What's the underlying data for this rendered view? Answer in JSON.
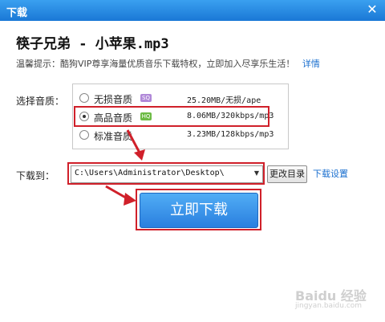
{
  "window": {
    "title": "下载",
    "close_glyph": "✕"
  },
  "song": {
    "name": "筷子兄弟 - 小苹果.mp3"
  },
  "tip": {
    "text": "温馨提示：酷狗VIP尊享海量优质音乐下载特权，立即加入尽享乐生活！",
    "link": "详情"
  },
  "quality": {
    "label": "选择音质：",
    "options": [
      {
        "name": "无损音质",
        "badge": "SQ",
        "badge_color": "#b088d8",
        "info": "25.20MB/无损/ape",
        "selected": false
      },
      {
        "name": "高品音质",
        "badge": "HQ",
        "badge_color": "#6dbb45",
        "info": "8.06MB/320kbps/mp3",
        "selected": true
      },
      {
        "name": "标准音质",
        "badge": "",
        "badge_color": "",
        "info": "3.23MB/128kbps/mp3",
        "selected": false
      }
    ]
  },
  "download_to": {
    "label": "下载到：",
    "path": "C:\\Users\\Administrator\\Desktop\\",
    "change_button": "更改目录",
    "settings_link": "下载设置"
  },
  "primary_button": {
    "label": "立即下载"
  },
  "watermark": {
    "logo": "Baidu 经验",
    "sub": "jingyan.baidu.com"
  },
  "colors": {
    "annotation_red": "#d0202a",
    "title_blue": "#1a78d6",
    "link_blue": "#1a6fcf"
  }
}
